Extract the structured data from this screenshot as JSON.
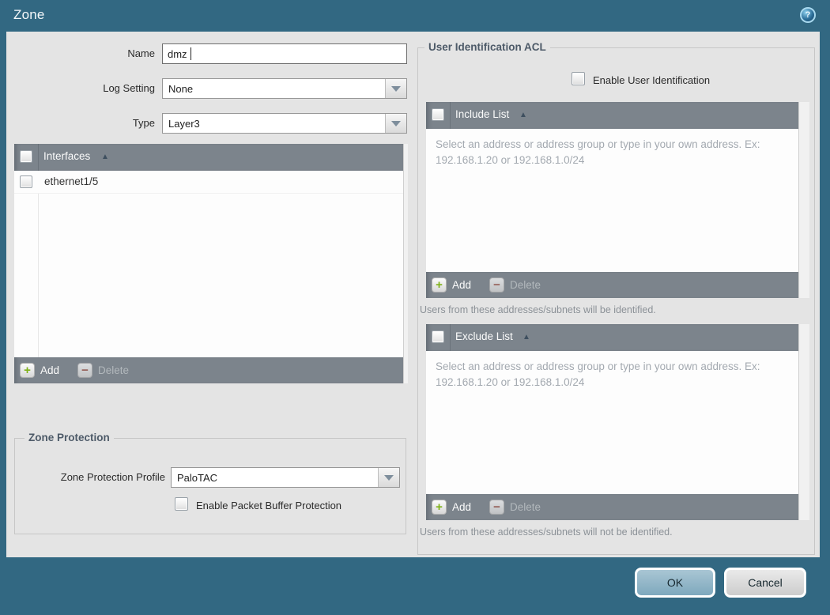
{
  "window": {
    "title": "Zone"
  },
  "icons": {
    "help": "?",
    "add": "+",
    "delete": "−",
    "sort_asc": "▲",
    "dropdown": "chevron-down"
  },
  "colors": {
    "titlebar_teal": "#326882",
    "content_gray": "#e4e4e4",
    "table_header_gray": "#7c848c",
    "add_green": "#7fb117",
    "delete_red": "#9c5043",
    "ok_button_blue": "#8fb4c9",
    "placeholder_gray": "#a3a9b0"
  },
  "left": {
    "name_label": "Name",
    "name_value": "dmz",
    "log_setting_label": "Log Setting",
    "log_setting_value": "None",
    "type_label": "Type",
    "type_value": "Layer3",
    "interfaces_table": {
      "header": "Interfaces",
      "rows": [
        {
          "label": "ethernet1/5"
        }
      ],
      "add_label": "Add",
      "delete_label": "Delete"
    },
    "zone_protection": {
      "legend": "Zone Protection",
      "profile_label": "Zone Protection Profile",
      "profile_value": "PaloTAC",
      "packet_buffer_label": "Enable Packet Buffer Protection"
    }
  },
  "right": {
    "legend": "User Identification ACL",
    "enable_label": "Enable User Identification",
    "include": {
      "header": "Include List",
      "placeholder": "Select an address or address group or type in your own address. Ex: 192.168.1.20 or 192.168.1.0/24",
      "add_label": "Add",
      "delete_label": "Delete",
      "note": "Users from these addresses/subnets will be identified."
    },
    "exclude": {
      "header": "Exclude List",
      "placeholder": "Select an address or address group or type in your own address. Ex: 192.168.1.20 or 192.168.1.0/24",
      "add_label": "Add",
      "delete_label": "Delete",
      "note": "Users from these addresses/subnets will not be identified."
    }
  },
  "footer": {
    "ok_label": "OK",
    "cancel_label": "Cancel"
  }
}
